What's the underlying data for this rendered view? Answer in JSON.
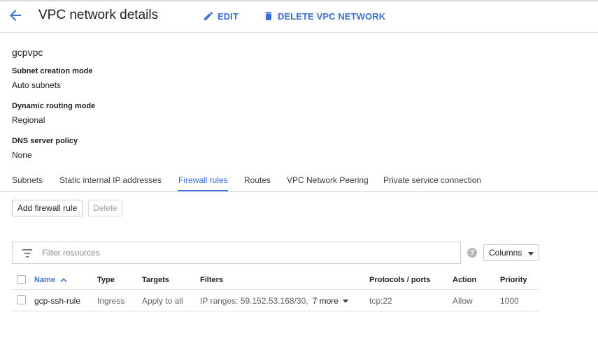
{
  "header": {
    "title": "VPC network details",
    "edit_label": "EDIT",
    "delete_label": "DELETE VPC NETWORK"
  },
  "network": {
    "name": "gcpvpc",
    "fields": [
      {
        "label": "Subnet creation mode",
        "value": "Auto subnets"
      },
      {
        "label": "Dynamic routing mode",
        "value": "Regional"
      },
      {
        "label": "DNS server policy",
        "value": "None"
      }
    ]
  },
  "tabs": [
    {
      "label": "Subnets",
      "active": false
    },
    {
      "label": "Static internal IP addresses",
      "active": false
    },
    {
      "label": "Firewall rules",
      "active": true
    },
    {
      "label": "Routes",
      "active": false
    },
    {
      "label": "VPC Network Peering",
      "active": false
    },
    {
      "label": "Private service connection",
      "active": false
    }
  ],
  "actions": {
    "add_label": "Add firewall rule",
    "delete_label": "Delete"
  },
  "filter": {
    "placeholder": "Filter resources",
    "help_glyph": "?",
    "columns_label": "Columns"
  },
  "table": {
    "headers": {
      "name": "Name",
      "type": "Type",
      "targets": "Targets",
      "filters": "Filters",
      "protocols": "Protocols / ports",
      "action": "Action",
      "priority": "Priority"
    },
    "rows": [
      {
        "name": "gcp-ssh-rule",
        "type": "Ingress",
        "targets": "Apply to all",
        "filters": "IP ranges: 59.152.53.168/30,",
        "more": "7 more",
        "protocols": "tcp:22",
        "action": "Allow",
        "priority": "1000"
      }
    ]
  },
  "colors": {
    "accent": "#3b6fd8",
    "text": "#202124",
    "muted": "#5f6368"
  }
}
